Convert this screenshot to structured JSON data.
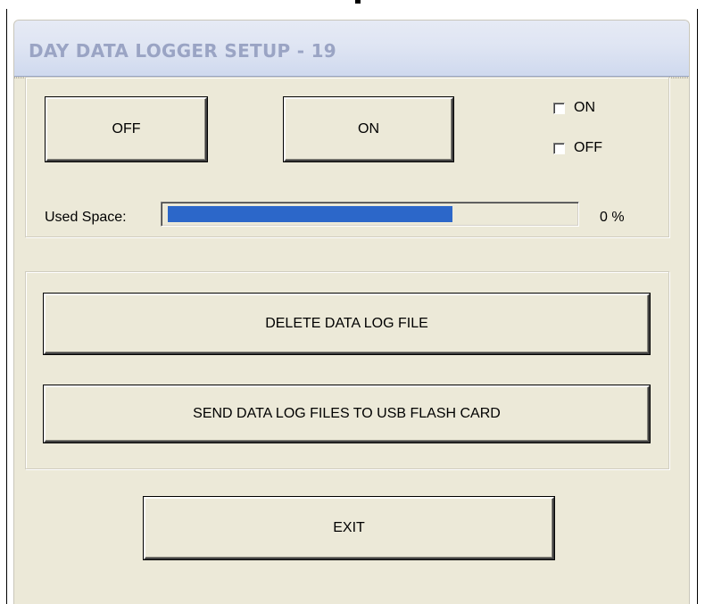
{
  "window": {
    "title": "DAY DATA LOGGER SETUP - 19"
  },
  "controls": {
    "off_button_label": "OFF",
    "on_button_label": "ON",
    "checkbox_on": {
      "label": "ON",
      "checked": false
    },
    "checkbox_off": {
      "label": "OFF",
      "checked": false
    }
  },
  "used_space": {
    "label": "Used Space:",
    "percent_text": "0 %",
    "bar_fill_fraction": 0.705,
    "bar_color": "#2c67c9"
  },
  "actions": {
    "delete_label": "DELETE DATA LOG FILE",
    "send_label": "SEND DATA LOG FILES TO USB FLASH CARD"
  },
  "footer": {
    "exit_label": "EXIT"
  }
}
